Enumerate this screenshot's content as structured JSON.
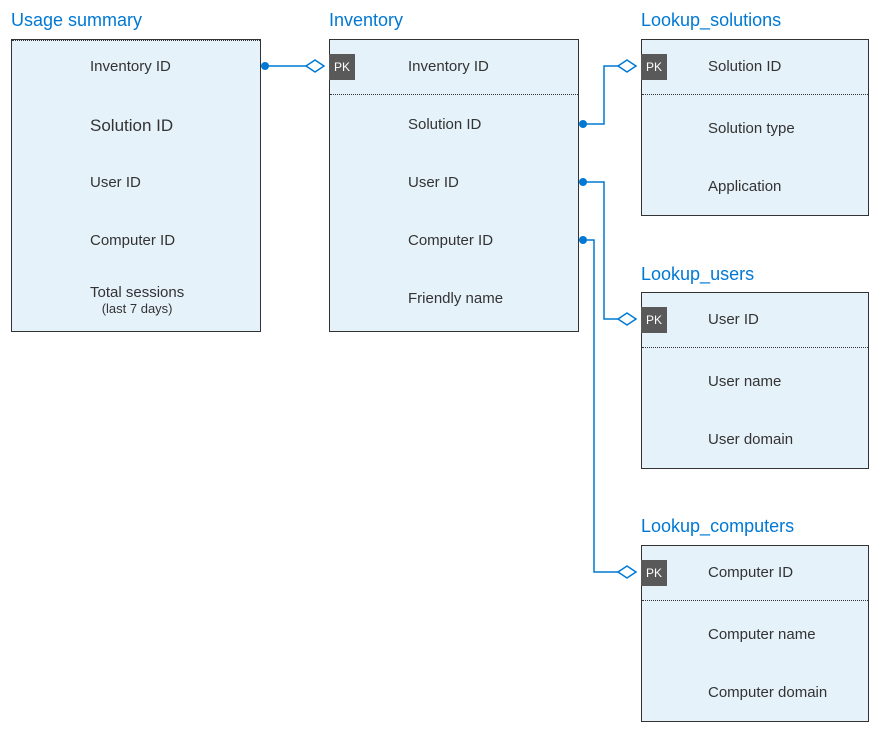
{
  "entities": {
    "usage_summary": {
      "title": "Usage summary",
      "fields": {
        "inventory_id": "Inventory ID",
        "solution_id": "Solution ID",
        "user_id": "User  ID",
        "computer_id": "Computer ID",
        "total_sessions": "Total sessions",
        "total_sessions_sub": "(last 7 days)"
      }
    },
    "inventory": {
      "title": "Inventory",
      "pk_label": "PK",
      "fields": {
        "inventory_id": "Inventory ID",
        "solution_id": "Solution ID",
        "user_id": "User ID",
        "computer_id": "Computer ID",
        "friendly_name": "Friendly name"
      }
    },
    "lookup_solutions": {
      "title": "Lookup_solutions",
      "pk_label": "PK",
      "fields": {
        "solution_id": "Solution ID",
        "solution_type": "Solution type",
        "application": "Application"
      }
    },
    "lookup_users": {
      "title": "Lookup_users",
      "pk_label": "PK",
      "fields": {
        "user_id": "User ID",
        "user_name": "User name",
        "user_domain": "User domain"
      }
    },
    "lookup_computers": {
      "title": "Lookup_computers",
      "pk_label": "PK",
      "fields": {
        "computer_id": "Computer ID",
        "computer_name": "Computer name",
        "computer_domain": "Computer domain"
      }
    }
  }
}
